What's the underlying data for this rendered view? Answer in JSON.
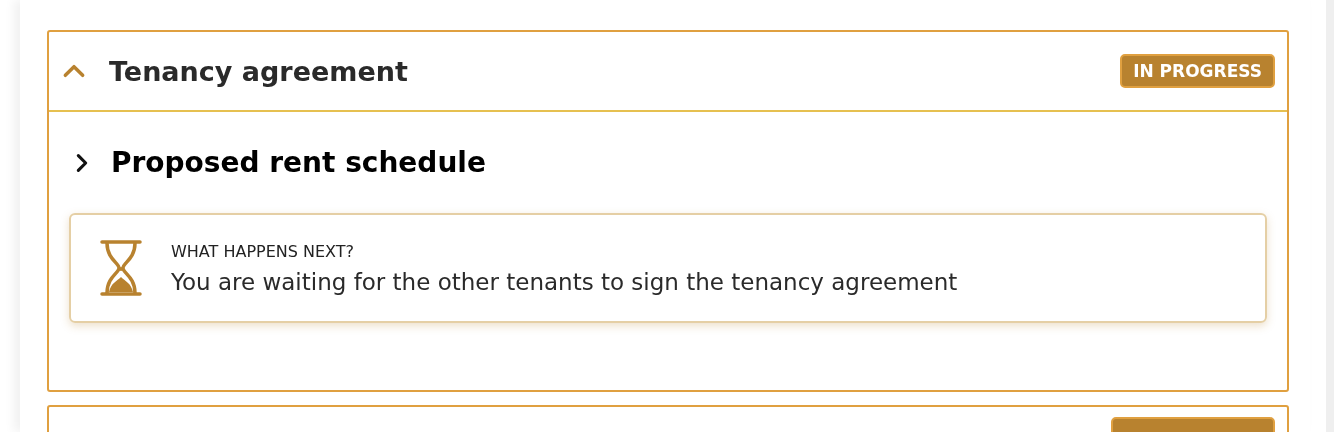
{
  "section": {
    "title": "Tenancy agreement",
    "expanded": true,
    "status": "IN PROGRESS",
    "subsection": {
      "title": "Proposed rent schedule",
      "expanded": false
    },
    "notice": {
      "label": "WHAT HAPPENS NEXT?",
      "message": "You are waiting for the other tenants to sign the tenancy agreement"
    }
  }
}
